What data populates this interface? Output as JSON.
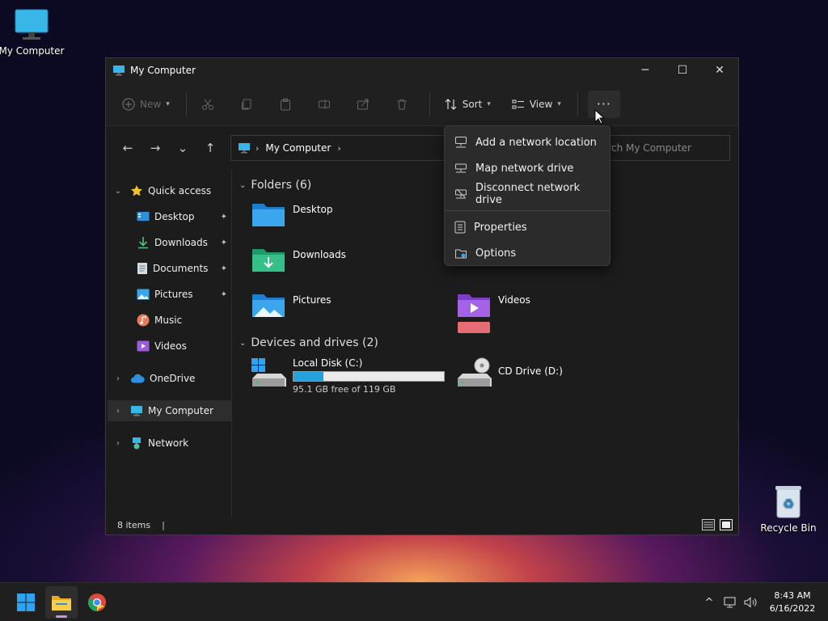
{
  "desktop": {
    "icons": [
      {
        "label": "My Computer",
        "icon": "monitor-icon"
      },
      {
        "label": "Recycle Bin",
        "icon": "recycle-bin-icon"
      }
    ]
  },
  "window": {
    "title": "My Computer",
    "controls": {
      "minimize": "─",
      "maximize": "☐",
      "close": "✕"
    }
  },
  "toolbar": {
    "new_label": "New",
    "sort_label": "Sort",
    "view_label": "View",
    "more_label": "···"
  },
  "nav": {
    "back": "←",
    "forward": "→",
    "recent": "⌄",
    "up": "↑",
    "address_root_sep": "›",
    "address_current": "My Computer",
    "address_trail_sep": "›",
    "search_placeholder": "Search My Computer"
  },
  "sidebar": {
    "items": [
      {
        "label": "Quick access",
        "chev": "⌄"
      },
      {
        "label": "Desktop",
        "pin": "📌"
      },
      {
        "label": "Downloads",
        "pin": "📌"
      },
      {
        "label": "Documents",
        "pin": "📌"
      },
      {
        "label": "Pictures",
        "pin": "📌"
      },
      {
        "label": "Music"
      },
      {
        "label": "Videos"
      },
      {
        "label": "OneDrive",
        "chev": "›"
      },
      {
        "label": "My Computer",
        "chev": "›"
      },
      {
        "label": "Network",
        "chev": "›"
      }
    ]
  },
  "content": {
    "folders_header": "Folders (6)",
    "folders": [
      {
        "label": "Desktop"
      },
      {
        "label": "Downloads"
      },
      {
        "label": "Pictures"
      },
      {
        "label": "Videos"
      }
    ],
    "drives_header": "Devices and drives (2)",
    "drives": [
      {
        "label": "Local Disk (C:)",
        "free_text": "95.1 GB free of 119 GB",
        "used_fraction": 0.2
      },
      {
        "label": "CD Drive (D:)"
      }
    ]
  },
  "status": {
    "items_text": "8 items",
    "cursor": "|"
  },
  "context_menu": {
    "items": [
      {
        "label": "Add a network location",
        "icon": "network-location-icon"
      },
      {
        "label": "Map network drive",
        "icon": "map-drive-icon"
      },
      {
        "label": "Disconnect network drive",
        "icon": "disconnect-drive-icon"
      },
      {
        "label": "Properties",
        "icon": "properties-icon"
      },
      {
        "label": "Options",
        "icon": "options-icon"
      }
    ]
  },
  "taskbar": {
    "tray_chevron": "^",
    "time": "8:43 AM",
    "date": "6/16/2022"
  },
  "colors": {
    "accent": "#26a0da",
    "window_bg": "#1c1c1c",
    "menu_bg": "#2b2b2b"
  }
}
